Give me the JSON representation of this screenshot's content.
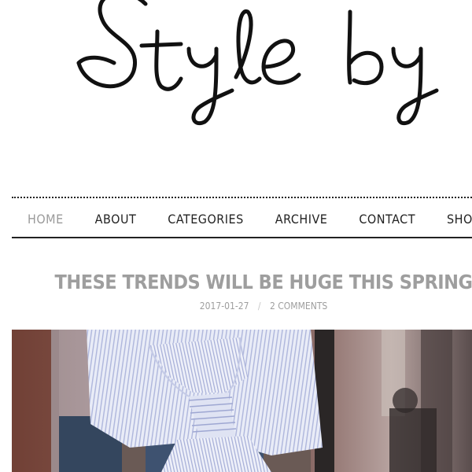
{
  "site": {
    "logo_text": "Style by"
  },
  "nav": {
    "items": [
      {
        "label": "HOME"
      },
      {
        "label": "ABOUT"
      },
      {
        "label": "CATEGORIES"
      },
      {
        "label": "ARCHIVE"
      },
      {
        "label": "CONTACT"
      },
      {
        "label": "SHOP"
      }
    ]
  },
  "post": {
    "title": "THESE TRENDS WILL BE HUGE THIS SPRING",
    "date": "2017-01-27",
    "separator": "/",
    "comments": "2 COMMENTS"
  },
  "colors": {
    "muted_text": "#9e9e9e",
    "nav_text": "#222222",
    "active_nav": "#9a9a9a"
  }
}
